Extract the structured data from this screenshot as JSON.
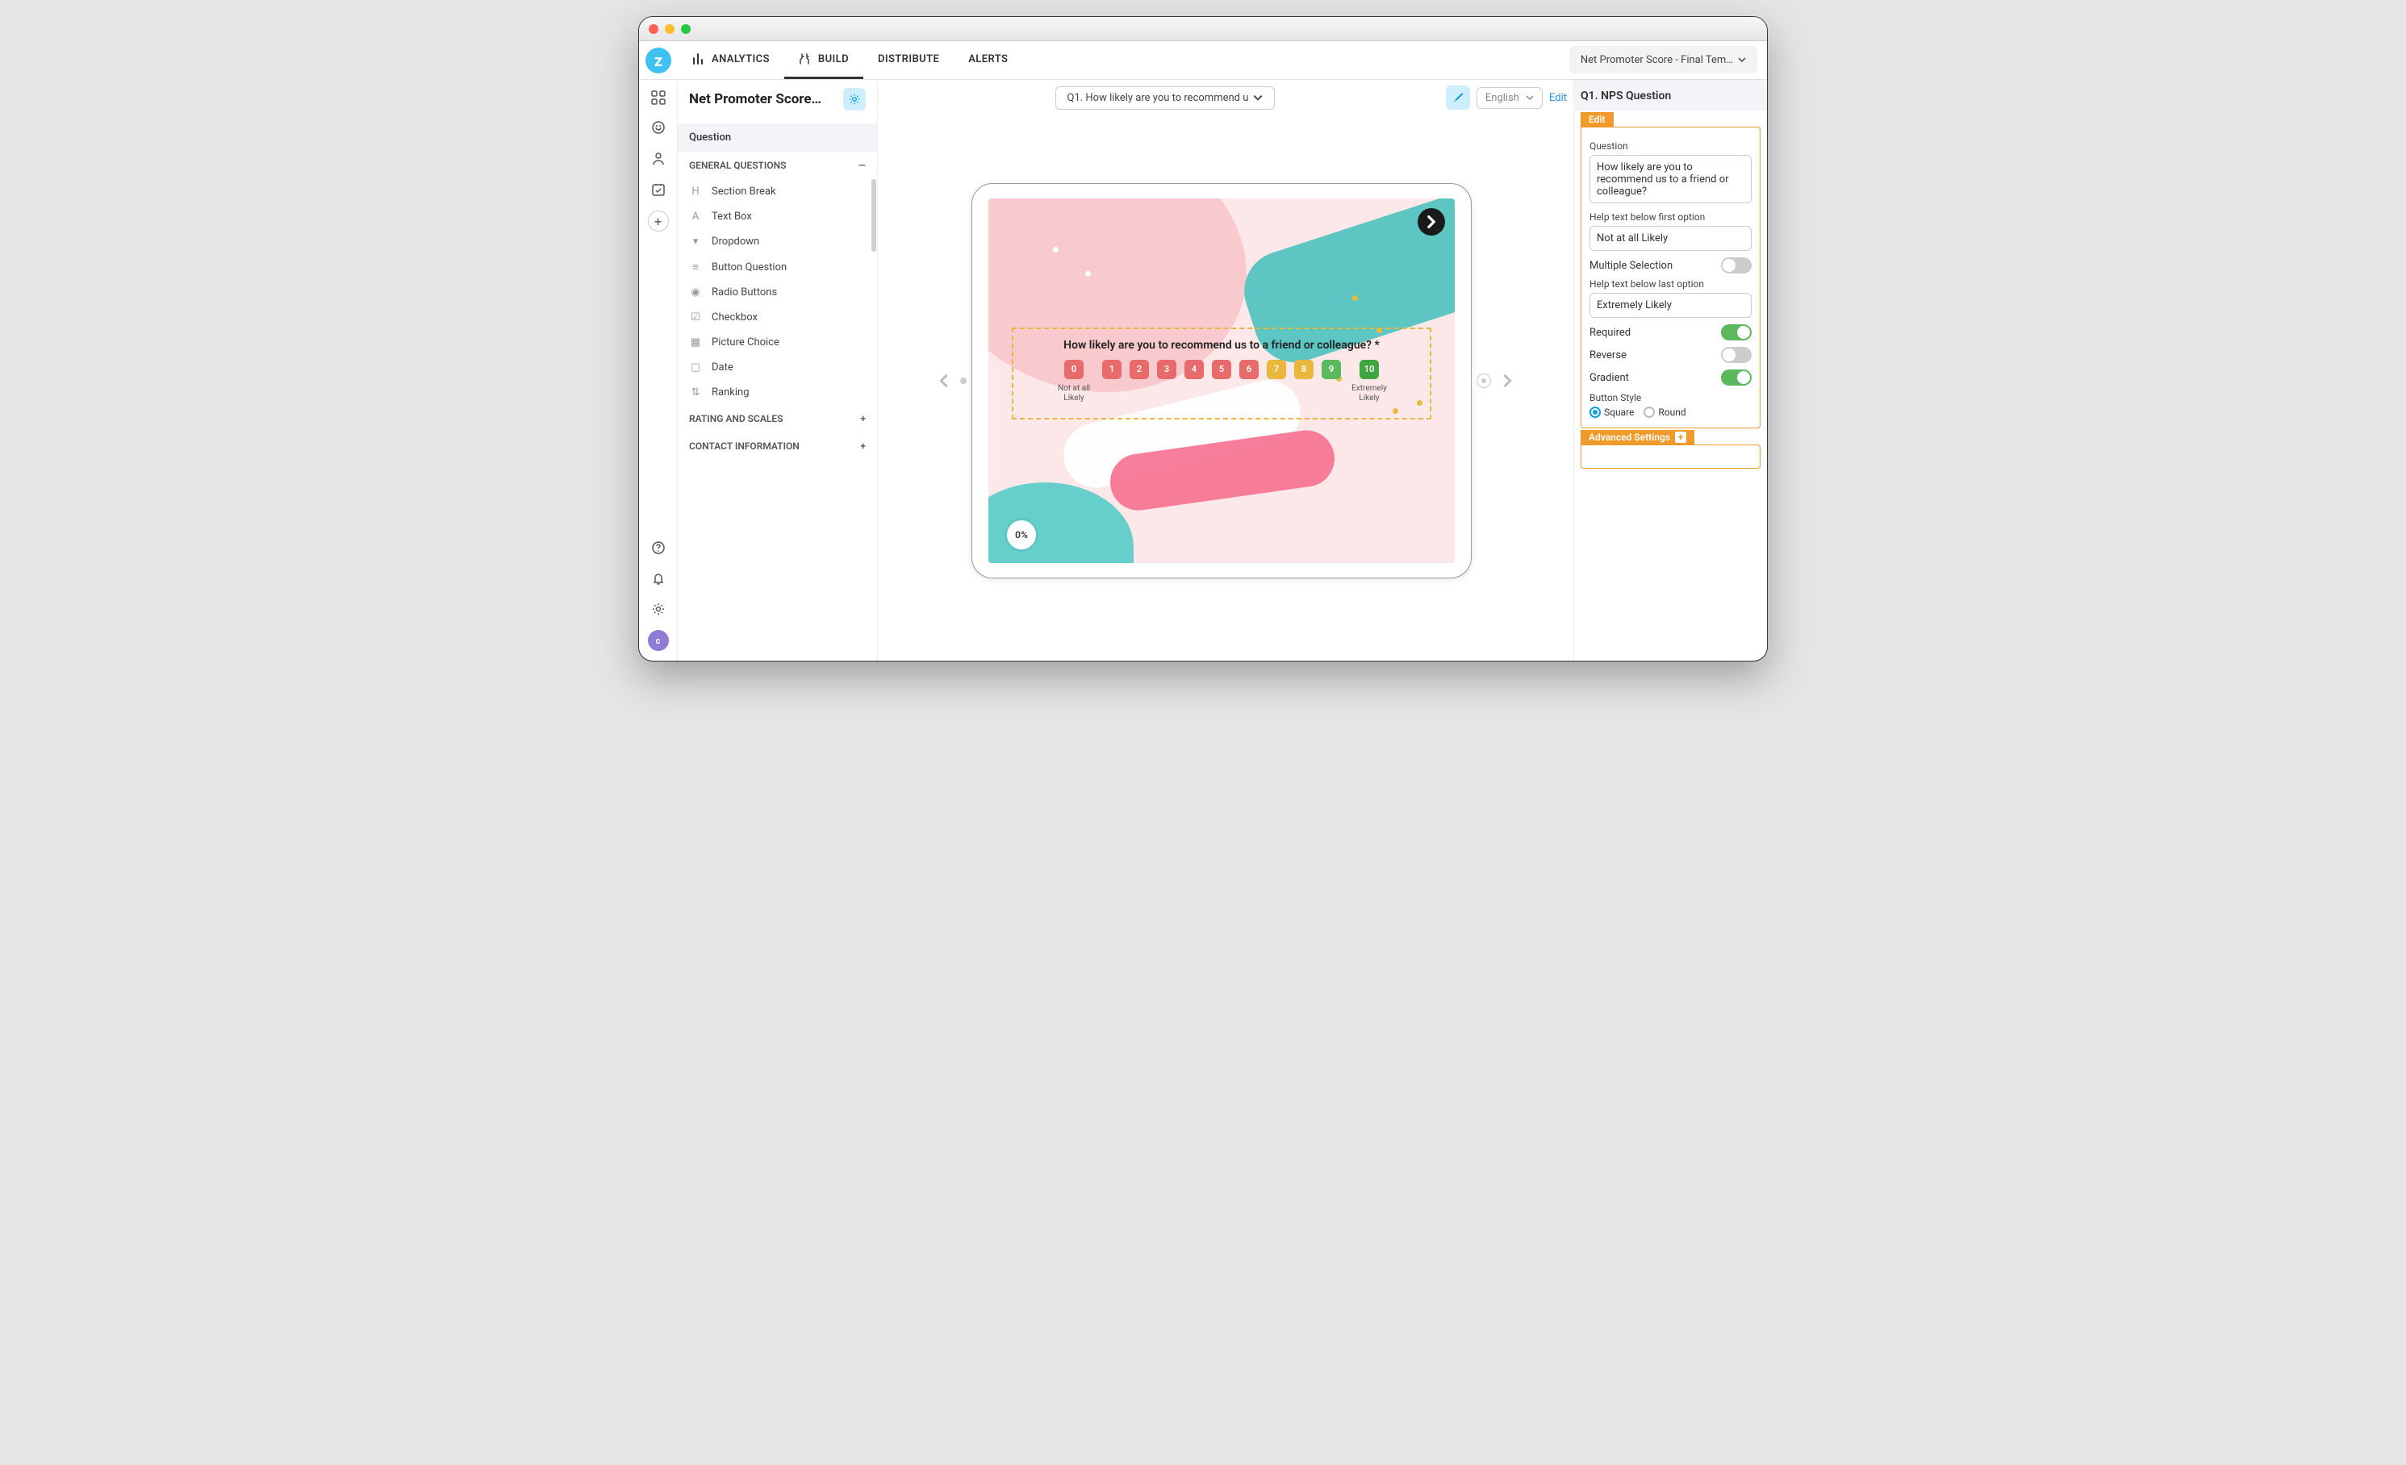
{
  "topnav": {
    "analytics": "ANALYTICS",
    "build": "BUILD",
    "distribute": "DISTRIBUTE",
    "alerts": "ALERTS",
    "template_selector": "Net Promoter Score - Final Tem…"
  },
  "leftpanel": {
    "title": "Net Promoter Score…",
    "section_question": "Question",
    "group_general": "GENERAL QUESTIONS",
    "items": [
      "Section Break",
      "Text Box",
      "Dropdown",
      "Button Question",
      "Radio Buttons",
      "Checkbox",
      "Picture Choice",
      "Date",
      "Ranking"
    ],
    "group_rating": "RATING AND SCALES",
    "group_contact": "CONTACT INFORMATION"
  },
  "center": {
    "question_selector": "Q1. How likely are you to recommend u",
    "lang": "English",
    "edit": "Edit",
    "nps_question": "How likely are you to recommend us to a friend or colleague? *",
    "scale_values": [
      "0",
      "1",
      "2",
      "3",
      "4",
      "5",
      "6",
      "7",
      "8",
      "9",
      "10"
    ],
    "label_low": "Not at all Likely",
    "label_high": "Extremely Likely",
    "progress": "0%"
  },
  "rightpanel": {
    "title": "Q1. NPS Question",
    "tab_edit": "Edit",
    "label_question": "Question",
    "value_question": "How likely are you to recommend us to a friend or colleague?",
    "label_help_first": "Help text below first option",
    "value_help_first": "Not at all Likely",
    "label_multiple": "Multiple Selection",
    "label_help_last": "Help text below last option",
    "value_help_last": "Extremely Likely",
    "label_required": "Required",
    "label_reverse": "Reverse",
    "label_gradient": "Gradient",
    "label_button_style": "Button Style",
    "radio_square": "Square",
    "radio_round": "Round",
    "advanced": "Advanced Settings"
  },
  "avatar": "c"
}
